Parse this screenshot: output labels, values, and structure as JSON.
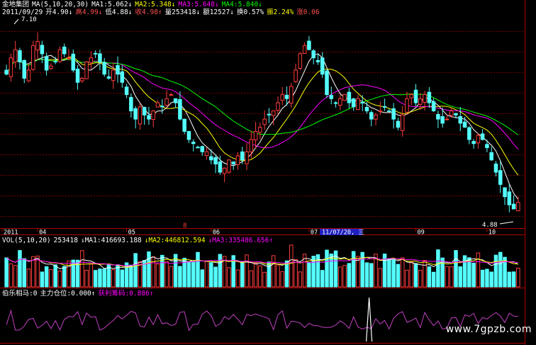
{
  "main": {
    "name": "金地集团",
    "ma_label": "MA(5,10,20,30)",
    "ma": [
      {
        "label": "MA1:5.062",
        "arrow": "↓",
        "color": "#ffffff"
      },
      {
        "label": "MA2:5.348",
        "arrow": "↓",
        "color": "#ffff00"
      },
      {
        "label": "MA3:5.648",
        "arrow": "↓",
        "color": "#ff00ff"
      },
      {
        "label": "MA4:5.840",
        "arrow": "↓",
        "color": "#00ff00"
      }
    ],
    "info": [
      {
        "text": "2011/09/29",
        "color": "#ffffff"
      },
      {
        "text": "开4.90↓",
        "color": "#ffffff"
      },
      {
        "text": "高4.99↓",
        "color": "#ff5050"
      },
      {
        "text": "低4.88↓",
        "color": "#ffffff"
      },
      {
        "text": "收4.98↑",
        "color": "#ff5050"
      },
      {
        "text": "量253418↓",
        "color": "#ffffff"
      },
      {
        "text": "额12527↓",
        "color": "#ffffff"
      },
      {
        "text": "换0.57%",
        "color": "#ffffff"
      },
      {
        "text": "振2.24%",
        "color": "#ffff00"
      },
      {
        "text": "涨0.06",
        "color": "#ff5050"
      }
    ],
    "high_label": "7.10",
    "low_label": "4.88",
    "marker_label": "8"
  },
  "date_axis": {
    "labels": [
      "2011",
      "04",
      "05",
      "06",
      "07",
      "09",
      "10"
    ],
    "cursor_label": "11/07/20, 三"
  },
  "vol_panel": {
    "title": "VOL(5,10,20)",
    "items": [
      {
        "text": "253418",
        "color": "#ffffff"
      },
      {
        "text": "↓MA1:416693.188",
        "color": "#ffffff"
      },
      {
        "text": "↓MA2:446812.594",
        "color": "#ffff00"
      },
      {
        "text": "↓MA3:335486.656↑",
        "color": "#ff00ff"
      }
    ]
  },
  "ind_panel": {
    "title": "伯乐相马",
    "items": [
      {
        "text": "伯乐相马:0",
        "color": "#ffffff"
      },
      {
        "text": "主力仓位:0.000↑",
        "color": "#ffffff"
      },
      {
        "text": "获利筹码:0.886↑",
        "color": "#ff00ff"
      }
    ]
  },
  "watermark": "www.7gpzb.com",
  "chart_data": {
    "type": "candlestick",
    "ylim": [
      4.7,
      7.25
    ],
    "x_axis_ticks": [
      "2011",
      "04",
      "05",
      "06",
      "07",
      "09",
      "10"
    ],
    "close_series": [
      6.55,
      6.75,
      6.85,
      6.7,
      6.5,
      6.6,
      6.9,
      6.95,
      6.8,
      6.6,
      6.65,
      6.7,
      6.85,
      6.8,
      6.75,
      6.6,
      6.45,
      6.5,
      6.7,
      6.75,
      6.8,
      6.7,
      6.55,
      6.5,
      6.6,
      6.55,
      6.45,
      6.3,
      6.1,
      6.0,
      6.15,
      6.05,
      6.0,
      6.1,
      6.2,
      6.15,
      6.25,
      6.3,
      6.2,
      6.0,
      5.85,
      5.75,
      5.7,
      5.65,
      5.6,
      5.6,
      5.5,
      5.45,
      5.35,
      5.4,
      5.5,
      5.45,
      5.55,
      5.5,
      5.6,
      5.75,
      5.85,
      5.9,
      6.0,
      6.05,
      6.1,
      6.2,
      6.3,
      6.25,
      6.4,
      6.6,
      6.8,
      6.9,
      6.85,
      6.75,
      6.7,
      6.55,
      6.3,
      6.25,
      6.2,
      6.25,
      6.3,
      6.2,
      6.15,
      6.25,
      6.2,
      6.1,
      6.0,
      6.05,
      6.1,
      6.15,
      6.1,
      6.0,
      5.9,
      6.05,
      6.25,
      6.3,
      6.2,
      6.25,
      6.3,
      6.2,
      6.1,
      6.0,
      5.95,
      6.0,
      6.1,
      6.05,
      5.95,
      5.9,
      5.75,
      5.7,
      5.8,
      5.75,
      5.65,
      5.5,
      5.35,
      5.2,
      5.05,
      4.95,
      4.9,
      4.98
    ],
    "ma_series": [
      "MA1",
      "MA2",
      "MA3",
      "MA4"
    ],
    "volume_panel": "VOL(5,10,20)",
    "indicator_panel": "伯乐相马",
    "indicator_peak": 1.0
  }
}
